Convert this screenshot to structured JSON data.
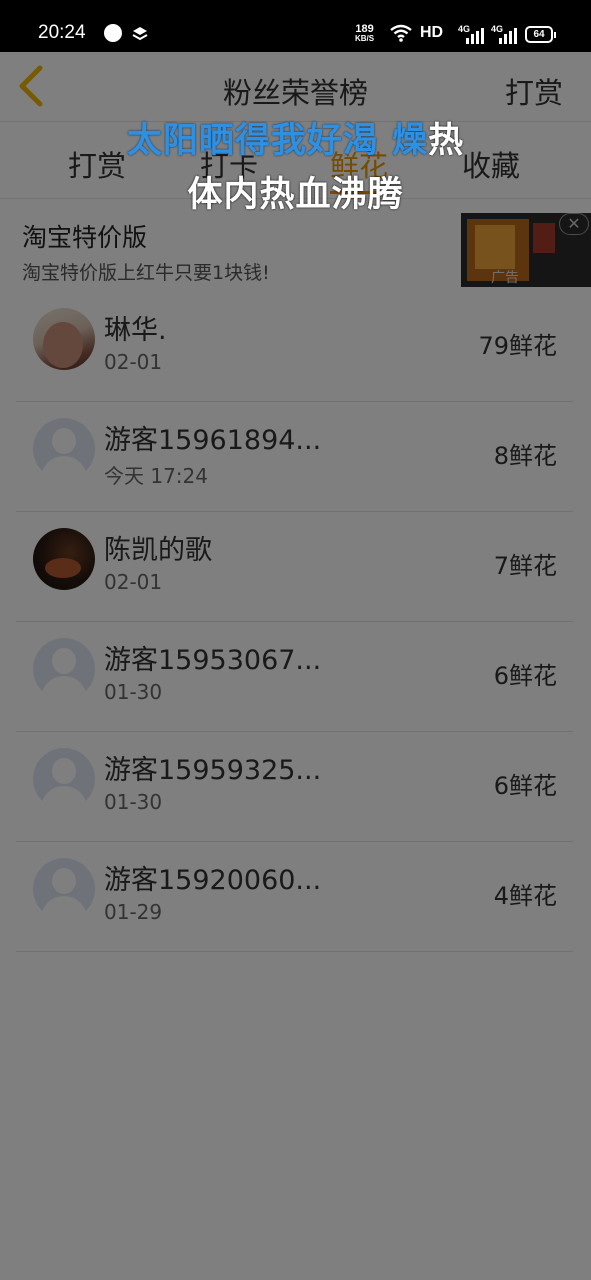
{
  "status_bar": {
    "time": "20:24",
    "net_speed_value": "189",
    "net_speed_unit": "KB/S",
    "hd_label": "HD",
    "signal_tag_1": "4G",
    "signal_tag_2": "4G",
    "battery_level": "64"
  },
  "header": {
    "title": "粉丝荣誉榜",
    "right_action": "打赏"
  },
  "tabs": [
    {
      "label": "打赏",
      "active": false
    },
    {
      "label": "打卡",
      "active": false
    },
    {
      "label": "鲜花",
      "active": true
    },
    {
      "label": "收藏",
      "active": false
    }
  ],
  "ad": {
    "title": "淘宝特价版",
    "subtitle": "淘宝特价版上红牛只要1块钱!",
    "label": "广告"
  },
  "fans": [
    {
      "name": "琳华.",
      "date": "02-01",
      "count": "79鲜花",
      "avatar": "photo"
    },
    {
      "name": "游客15961894...",
      "date": "今天 17:24",
      "count": "8鲜花",
      "avatar": "default"
    },
    {
      "name": "陈凯的歌",
      "date": "02-01",
      "count": "7鲜花",
      "avatar": "photo"
    },
    {
      "name": "游客15953067...",
      "date": "01-30",
      "count": "6鲜花",
      "avatar": "default"
    },
    {
      "name": "游客15959325...",
      "date": "01-30",
      "count": "6鲜花",
      "avatar": "default"
    },
    {
      "name": "游客15920060...",
      "date": "01-29",
      "count": "4鲜花",
      "avatar": "default"
    }
  ],
  "lyrics": {
    "line1_sung": "太阳晒得我好渴 燥",
    "line1_rest": "热",
    "line2": "体内热血沸腾"
  },
  "colors": {
    "accent": "#e89a00",
    "lyric_highlight": "#2f8fe0"
  }
}
